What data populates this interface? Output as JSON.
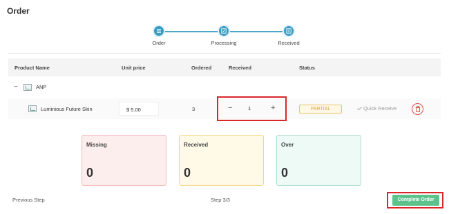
{
  "page": {
    "title": "Order"
  },
  "stepper": {
    "steps": [
      {
        "label": "Order",
        "icon": "list-icon"
      },
      {
        "label": "Processing",
        "icon": "edit-icon"
      },
      {
        "label": "Received",
        "icon": "check-list-icon"
      }
    ],
    "accent_color": "#3a9cc4"
  },
  "table": {
    "headers": {
      "product_name": "Product Name",
      "unit_price": "Unit price",
      "ordered": "Ordered",
      "received": "Received",
      "status": "Status"
    },
    "group": {
      "name": "ANP",
      "icon": "collapse-minus-icon"
    },
    "row": {
      "product_name": "Luminious Future Skin",
      "unit_price": "$ 5.00",
      "ordered": "3",
      "received_qty": "1",
      "minus_label": "−",
      "plus_label": "+",
      "status": "PARTIAL",
      "status_color": "#d8a63a",
      "quick_receive_label": "Quick Receive"
    }
  },
  "summary": {
    "missing": {
      "label": "Missing",
      "value": "0"
    },
    "received": {
      "label": "Received",
      "value": "0"
    },
    "over": {
      "label": "Over",
      "value": "0"
    }
  },
  "footer": {
    "previous_label": "Previous Step",
    "step_indicator": "Step 3/3",
    "complete_label": "Complete Order",
    "complete_color": "#5cc28b"
  }
}
